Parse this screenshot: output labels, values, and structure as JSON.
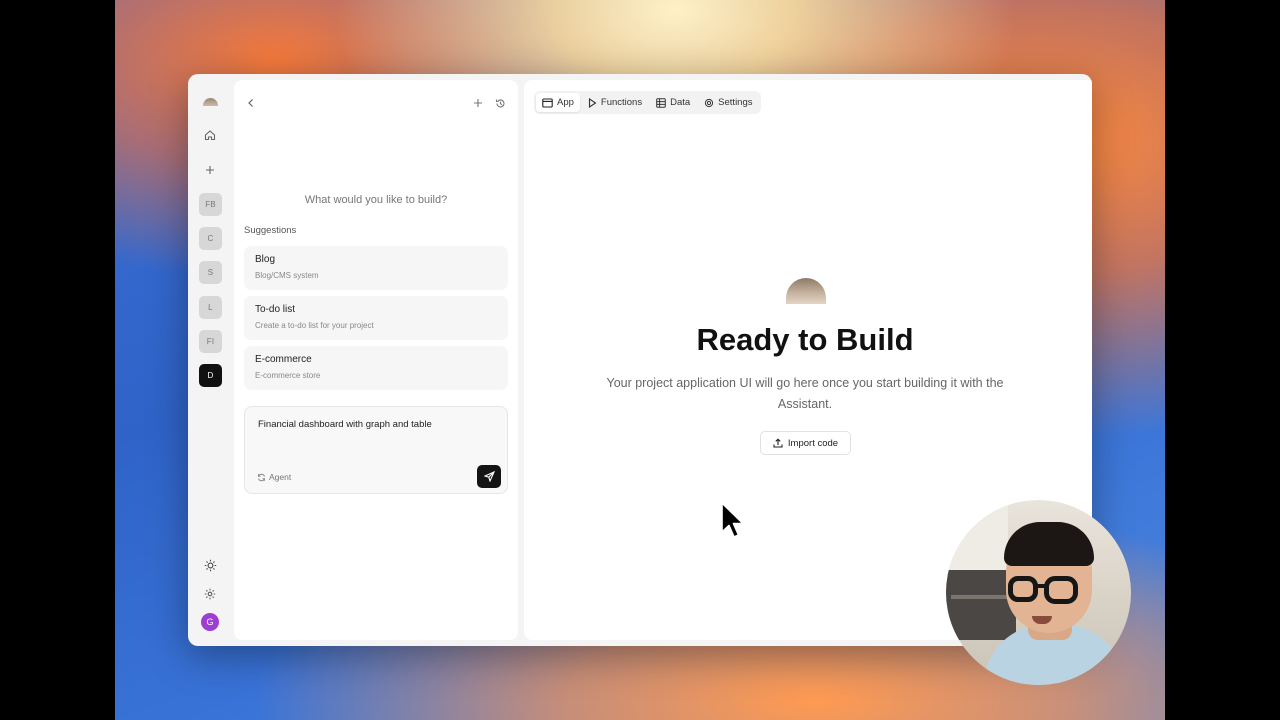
{
  "rail": {
    "projects": [
      "FB",
      "C",
      "S",
      "L",
      "FI",
      "D"
    ],
    "active_project": "D",
    "avatar_letter": "G"
  },
  "chat": {
    "prompt_question": "What would you like to build?",
    "suggestions_title": "Suggestions",
    "suggestions": [
      {
        "title": "Blog",
        "desc": "Blog/CMS system"
      },
      {
        "title": "To-do list",
        "desc": "Create a to-do list for your project"
      },
      {
        "title": "E-commerce",
        "desc": "E-commerce store"
      }
    ],
    "composer_text": "Financial dashboard with graph and table",
    "mode_label": "Agent"
  },
  "main": {
    "tabs": [
      {
        "label": "App",
        "icon": "window-icon",
        "active": true
      },
      {
        "label": "Functions",
        "icon": "play-icon",
        "active": false
      },
      {
        "label": "Data",
        "icon": "table-icon",
        "active": false
      },
      {
        "label": "Settings",
        "icon": "gear-icon",
        "active": false
      }
    ],
    "heading": "Ready to Build",
    "description": "Your project application UI will go here once you start building it with the Assistant.",
    "import_label": "Import code"
  },
  "colors": {
    "accent_dark": "#141414",
    "avatar": "#9c3fd1",
    "panel_bg": "#f4f4f4"
  }
}
